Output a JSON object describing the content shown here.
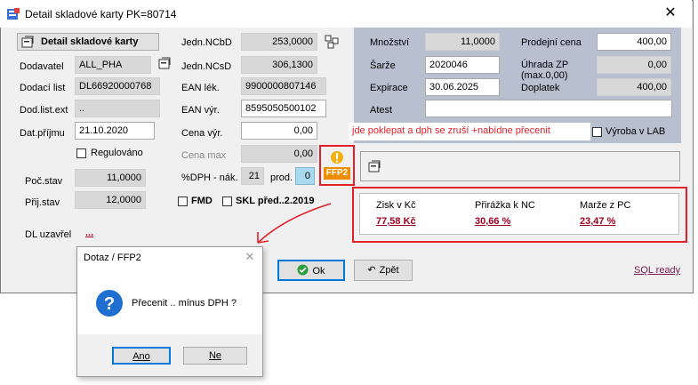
{
  "window": {
    "title": "Detail skladové karty PK=80714",
    "close": "✕"
  },
  "header_button": "Detail skladové karty",
  "left": {
    "dodavatel_label": "Dodavatel",
    "dodavatel_value": "ALL_PHA",
    "dodaci_list_label": "Dodací list",
    "dodaci_list_value": "DL66920000768",
    "dod_list_ext_label": "Dod.list.ext",
    "dod_list_ext_value": "..",
    "dat_prijmu_label": "Dat.příjmu",
    "dat_prijmu_value": "21.10.2020",
    "regulovano_label": "Regulováno",
    "poc_stav_label": "Poč.stav",
    "poc_stav_value": "11,0000",
    "prij_stav_label": "Přij.stav",
    "prij_stav_value": "12,0000",
    "fmd_label": "FMD",
    "skl_label": "SKL před..2.2019",
    "dl_uzavrel_label": "DL uzavřel",
    "dl_uzavrel_value": "..."
  },
  "mid": {
    "jedn_ncbd_label": "Jedn.NCbD",
    "jedn_ncbd_value": "253,0000",
    "jedn_ncsd_label": "Jedn.NCsD",
    "jedn_ncsd_value": "306,1300",
    "ean_lek_label": "EAN lék.",
    "ean_lek_value": "9900000807146",
    "ean_vyr_label": "EAN výr.",
    "ean_vyr_value": "8595050500102",
    "cena_vyr_label": "Cena výr.",
    "cena_vyr_value": "0,00",
    "cena_max_label": "Cena max",
    "cena_max_value": "0,00",
    "dph_label": "%DPH - nák.",
    "dph_value": "21",
    "prod_label": "prod.",
    "prod_value": "0"
  },
  "right": {
    "mnozstvi_label": "Množství",
    "mnozstvi_value": "11,0000",
    "prodejni_cena_label": "Prodejní cena",
    "prodejni_cena_value": "400,00",
    "sarze_label": "Šarže",
    "sarze_value": "2020046",
    "uhrada_label": "Úhrada ZP",
    "uhrada_sub": "(max.0,00)",
    "uhrada_value": "0,00",
    "expirace_label": "Expirace",
    "expirace_value": "30.06.2025",
    "doplatek_label": "Doplatek",
    "doplatek_value": "400,00",
    "atest_label": "Atest",
    "atest_value": "",
    "vyroba_label": "Výroba v LAB"
  },
  "annotation": "jde poklepat a dph se zruší +nabídne přecenit",
  "ffp2_badge": "FFP2",
  "profit": {
    "zisk_label": "Zisk v Kč",
    "zisk_value": "77,58 Kč",
    "prirazka_label": "Přirážka k NC",
    "prirazka_value": "30,66 %",
    "marze_label": "Marže z PC",
    "marze_value": "23,47 %"
  },
  "buttons": {
    "ok": "Ok",
    "zpet": "Zpět"
  },
  "ready_link": "SQL ready",
  "dialog": {
    "title": "Dotaz / FFP2",
    "message": "Přecenit .. mínus DPH ?",
    "yes": "Ano",
    "no": "Ne"
  },
  "colors": {
    "accent_red": "#e0202a",
    "link_red": "#a00020",
    "panel_blue": "#b8bfcf"
  }
}
